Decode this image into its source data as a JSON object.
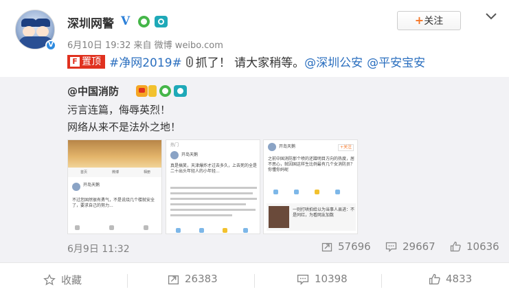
{
  "post": {
    "author": "深圳网警",
    "verified_icon": "V",
    "meta": "6月10日 19:32 来自 微博 weibo.com",
    "follow_label": "关注",
    "pin_label": "置顶",
    "pin_icon_glyph": "F",
    "text": {
      "hashtag": "#净网2019#",
      "body": "抓了！ 请大家稍等。",
      "mention1": "@深圳公安",
      "mention2": "@平安宝安"
    }
  },
  "repost": {
    "author": "@中国消防",
    "line1": "污言连篇，侮辱英烈！",
    "line2": "网络从来不是法外之地！",
    "date": "6月9日 11:32",
    "reposts": "57696",
    "comments": "29667",
    "likes": "10636",
    "thumbs": {
      "t1": {
        "tabs": [
          "首页",
          "微博",
          "相册"
        ],
        "name": "开岛天鹅",
        "text": "不过您固然很有勇气，不是说烧几个楼就安全了，要求自己的努力..."
      },
      "t2": {
        "header": "热门",
        "name": "开岛天鹅",
        "text": "真是搞笑，天津爆炸才过去多久，上去死的全是二十出头年轻人的小年轻..."
      },
      "t3": {
        "name": "开岛天鹅",
        "follow": "+关注",
        "text": "之前中国消防那个喷的还蹭明目方向的热度，居不思心，就因国这样生比例最有几个女消防员？你懂你妈呢",
        "sub": "一则打哄拍给以为当事人县进：不是同红，为看网友加数"
      }
    }
  },
  "actions": {
    "favorite": "收藏",
    "forward": "26383",
    "comment": "10398",
    "like": "4833"
  },
  "colors": {
    "link": "#2b6fbf",
    "pin": "#e0311f",
    "verified": "#2b7fd8"
  }
}
